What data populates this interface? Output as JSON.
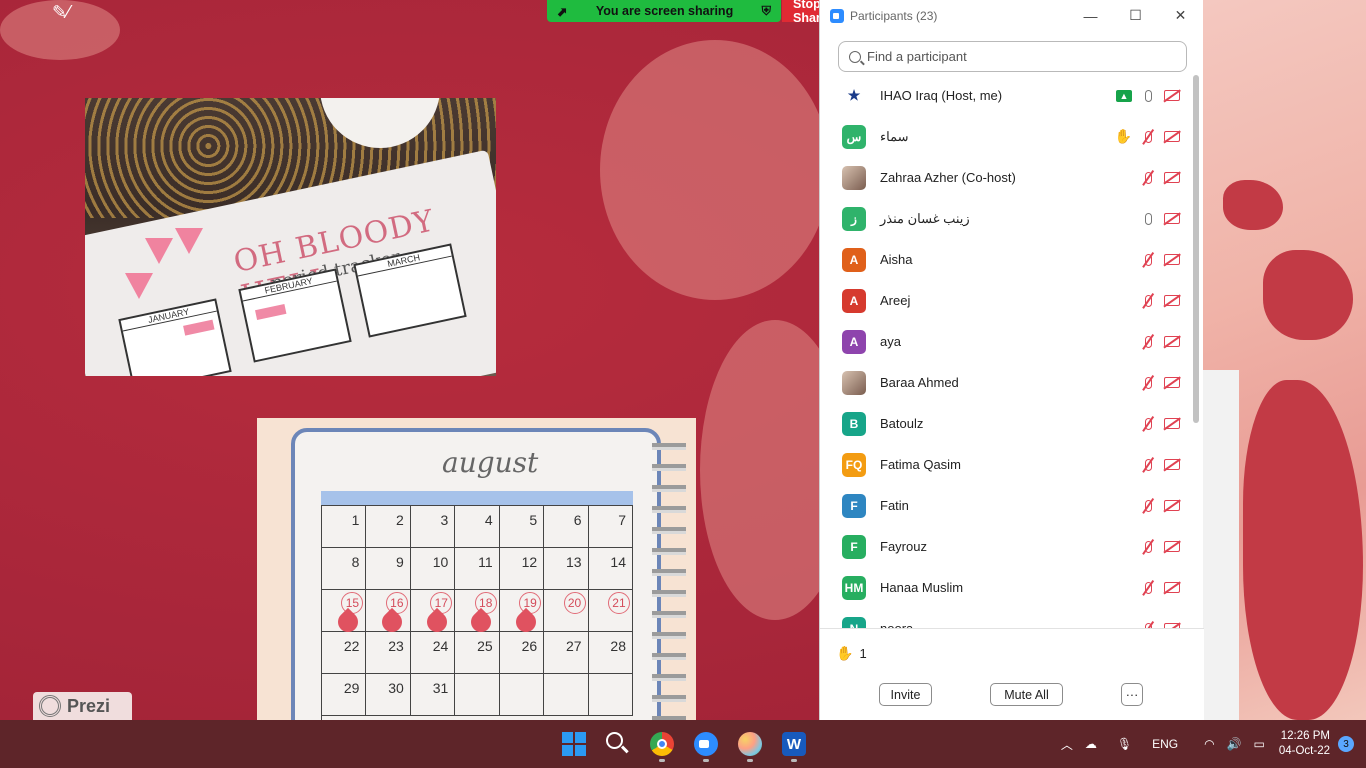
{
  "share_banner": {
    "text": "You are screen sharing",
    "stop_label": "Stop Share"
  },
  "panel": {
    "title": "Participants (23)",
    "search_placeholder": "Find a participant",
    "participants": [
      {
        "name": "IHAO Iraq (Host, me)",
        "avatar": "★",
        "avatar_color": "#ffffff",
        "mic": "on",
        "video": "off",
        "sharing": true,
        "hand": false
      },
      {
        "name": "سماء",
        "avatar": "س",
        "avatar_color": "#2fb36b",
        "mic": "off",
        "video": "off",
        "sharing": false,
        "hand": true
      },
      {
        "name": "Zahraa Azher (Co-host)",
        "avatar": "",
        "avatar_color": "photo",
        "mic": "off",
        "video": "off",
        "sharing": false,
        "hand": false
      },
      {
        "name": "زينب غسان منذر",
        "avatar": "ز",
        "avatar_color": "#2fb36b",
        "mic": "on",
        "video": "off",
        "sharing": false,
        "hand": false
      },
      {
        "name": "Aisha",
        "avatar": "A",
        "avatar_color": "#e0601a",
        "mic": "off",
        "video": "off",
        "sharing": false,
        "hand": false
      },
      {
        "name": "Areej",
        "avatar": "A",
        "avatar_color": "#d63a2e",
        "mic": "off",
        "video": "off",
        "sharing": false,
        "hand": false
      },
      {
        "name": "aya",
        "avatar": "A",
        "avatar_color": "#8e44ad",
        "mic": "off",
        "video": "off",
        "sharing": false,
        "hand": false
      },
      {
        "name": "Baraa Ahmed",
        "avatar": "",
        "avatar_color": "photo",
        "mic": "off",
        "video": "off",
        "sharing": false,
        "hand": false
      },
      {
        "name": "Batoulz",
        "avatar": "B",
        "avatar_color": "#17a589",
        "mic": "off",
        "video": "off",
        "sharing": false,
        "hand": false
      },
      {
        "name": "Fatima Qasim",
        "avatar": "FQ",
        "avatar_color": "#f39c12",
        "mic": "off",
        "video": "off",
        "sharing": false,
        "hand": false
      },
      {
        "name": "Fatin",
        "avatar": "F",
        "avatar_color": "#2e86c1",
        "mic": "off",
        "video": "off",
        "sharing": false,
        "hand": false
      },
      {
        "name": "Fayrouz",
        "avatar": "F",
        "avatar_color": "#27ae60",
        "mic": "off",
        "video": "off",
        "sharing": false,
        "hand": false
      },
      {
        "name": "Hanaa Muslim",
        "avatar": "HM",
        "avatar_color": "#27ae60",
        "mic": "off",
        "video": "off",
        "sharing": false,
        "hand": false
      },
      {
        "name": "noora",
        "avatar": "N",
        "avatar_color": "#17a589",
        "mic": "off",
        "video": "off",
        "sharing": false,
        "hand": false
      }
    ],
    "raised_hands_count": "1",
    "invite_label": "Invite",
    "mute_all_label": "Mute All",
    "more_label": "···"
  },
  "slide": {
    "notebook_title": "OH BLOODY HELL",
    "notebook_subtitle": "period tracker",
    "mini_months": [
      "JANUARY",
      "FEBRUARY",
      "MARCH"
    ],
    "calendar_month": "august",
    "calendar_days": [
      [
        "1",
        "2",
        "3",
        "4",
        "5",
        "6",
        "7"
      ],
      [
        "8",
        "9",
        "10",
        "11",
        "12",
        "13",
        "14"
      ],
      [
        "15",
        "16",
        "17",
        "18",
        "19",
        "20",
        "21"
      ],
      [
        "22",
        "23",
        "24",
        "25",
        "26",
        "27",
        "28"
      ],
      [
        "29",
        "30",
        "31",
        "",
        "",
        "",
        ""
      ]
    ],
    "circled_days": [
      "15",
      "16",
      "17",
      "18",
      "19",
      "20",
      "21"
    ],
    "drop_days": [
      "15",
      "16",
      "17",
      "18",
      "19"
    ],
    "prezi_label": "Prezi"
  },
  "taskbar": {
    "language": "ENG",
    "time": "12:26 PM",
    "date": "04-Oct-22",
    "notification_count": "3"
  }
}
